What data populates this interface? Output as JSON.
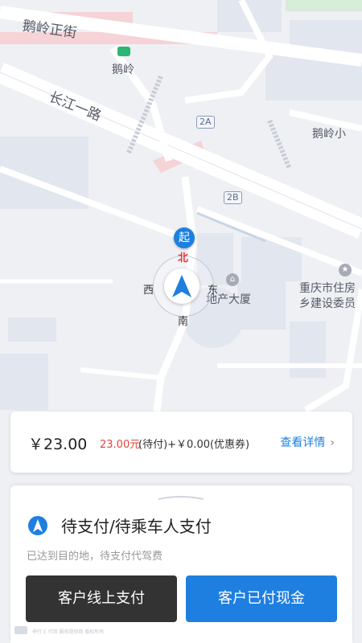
{
  "map": {
    "streets": {
      "eling_zheng": "鹅岭正街",
      "changjiang_1": "长江一路"
    },
    "metro_station": "鹅岭",
    "road_badges": [
      "2A",
      "2B"
    ],
    "pois": {
      "eling_school": "鹅岭小",
      "real_estate_building": "地产大厦",
      "housing_bureau_line1": "重庆市住房",
      "housing_bureau_line2": "乡建设委员"
    },
    "start_marker": "起",
    "compass": {
      "north": "北",
      "south": "南",
      "east": "东",
      "west": "西"
    },
    "colors": {
      "road": "#ffffff",
      "land": "#eef0f4",
      "building": "#e2e6ee",
      "rail": "#f5d3d6",
      "park": "#d7ecd9"
    }
  },
  "fare": {
    "total": "￥23.00",
    "pending": "23.00元",
    "rest": "(待付)+￥0.00(优惠券)",
    "detail_label": "查看详情",
    "detail_chevron": "›"
  },
  "status": {
    "icon": "navigation-arrow-icon",
    "title": "待支付/待乘车人支付",
    "subtitle": "已达到目的地，待支付代驾费"
  },
  "actions": {
    "online_pay_label": "客户线上支付",
    "cash_paid_label": "客户已付现金"
  },
  "footer": {
    "note": "申行 E 代驾 服务提供商 版权所有"
  },
  "colors": {
    "accent": "#1e7fe0",
    "dark_button": "#333333",
    "price_red": "#e0453a"
  }
}
